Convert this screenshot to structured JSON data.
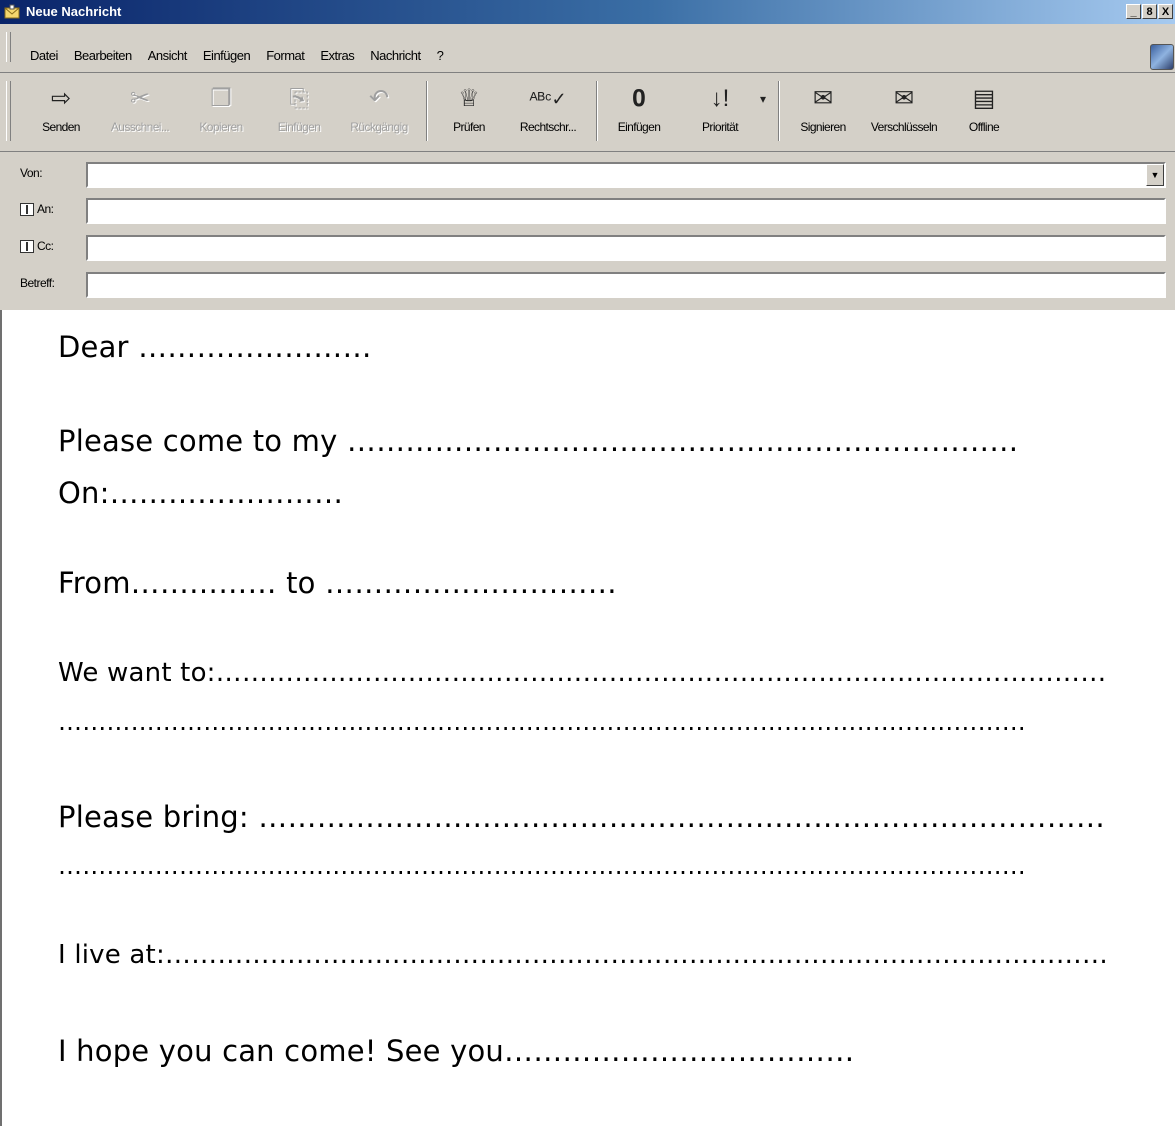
{
  "window": {
    "title": "Neue Nachricht",
    "icon": "envelope-icon",
    "controls": [
      "_",
      "8",
      "X"
    ]
  },
  "menu": {
    "items": [
      "Datei",
      "Bearbeiten",
      "Ansicht",
      "Einfügen",
      "Format",
      "Extras",
      "Nachricht",
      "?"
    ]
  },
  "toolbar": {
    "buttons": [
      {
        "label": "Senden",
        "icon": "send-icon",
        "enabled": true
      },
      {
        "label": "Ausschnei...",
        "icon": "cut-icon",
        "enabled": false
      },
      {
        "label": "Kopieren",
        "icon": "copy-icon",
        "enabled": false
      },
      {
        "label": "Einfügen",
        "icon": "paste-icon",
        "enabled": false
      },
      {
        "label": "Rückgängig",
        "icon": "undo-icon",
        "enabled": false
      },
      {
        "label": "Prüfen",
        "icon": "check-names-icon",
        "enabled": true
      },
      {
        "label": "Rechtschr...",
        "icon": "spelling-icon",
        "enabled": true
      },
      {
        "label": "Einfügen",
        "icon": "attach-icon",
        "enabled": true
      },
      {
        "label": "Priorität",
        "icon": "priority-icon",
        "enabled": true
      },
      {
        "label": "Signieren",
        "icon": "sign-icon",
        "enabled": true
      },
      {
        "label": "Verschlüsseln",
        "icon": "encrypt-icon",
        "enabled": true
      },
      {
        "label": "Offline",
        "icon": "offline-icon",
        "enabled": true
      }
    ]
  },
  "headers": {
    "von_label": "Von:",
    "an_label": "An:",
    "cc_label": "Cc:",
    "betreff_label": "Betreff:",
    "von_value": "",
    "an_value": "",
    "cc_value": "",
    "betreff_value": ""
  },
  "body": {
    "lines": [
      "Dear ……………………",
      "Please come to my ……………………………………………………………",
      "On:……………………",
      "From…………… to …………………………",
      "We want to:…………………………………………………………………………………………",
      "…………………………………………………………………………………………………………",
      "Please bring: ……………………………………………………………………………",
      "…………………………………………………………………………………………………………",
      "I live at:………………………………………………………………………………………………",
      "I hope you can come! See you………………………………"
    ]
  }
}
